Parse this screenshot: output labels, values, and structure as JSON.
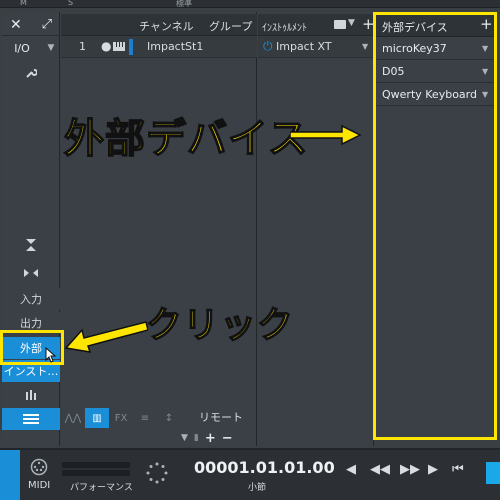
{
  "top_strip": {
    "left_label": "M",
    "mid_label": "S",
    "right_label": "標準"
  },
  "sidebar": {
    "close_glyph": "✕",
    "expand_glyph": "⤢",
    "io_label": "I/O",
    "wrench_glyph": "🔧",
    "items": [
      {
        "label": "入力",
        "active": false
      },
      {
        "label": "出力",
        "active": false
      },
      {
        "label": "外部",
        "active": true
      },
      {
        "label": "インスト…",
        "active": false
      }
    ]
  },
  "tracks": {
    "header_channel": "チャンネル",
    "header_group": "グループ",
    "rows": [
      {
        "number": "1",
        "name": "ImpactSt1"
      }
    ],
    "footer": {
      "remote_label": "リモート",
      "fx_label": "FX"
    }
  },
  "instruments": {
    "header": "ｲﾝｽﾄｩﾙﾒﾝﾄ",
    "rows": [
      {
        "name": "Impact XT"
      }
    ]
  },
  "external_devices": {
    "header": "外部デバイス",
    "devices": [
      "microKey37",
      "D05",
      "Qwerty Keyboard"
    ]
  },
  "annotations": {
    "title": "外部デバイス",
    "click": "クリック",
    "color": "#ffe600"
  },
  "transport": {
    "midi_label": "MIDI",
    "performance_label": "パフォーマンス",
    "time": "00001.01.01.00",
    "time_unit": "小節"
  },
  "colors": {
    "accent": "#1a8fd8",
    "highlight": "#ffe600"
  }
}
